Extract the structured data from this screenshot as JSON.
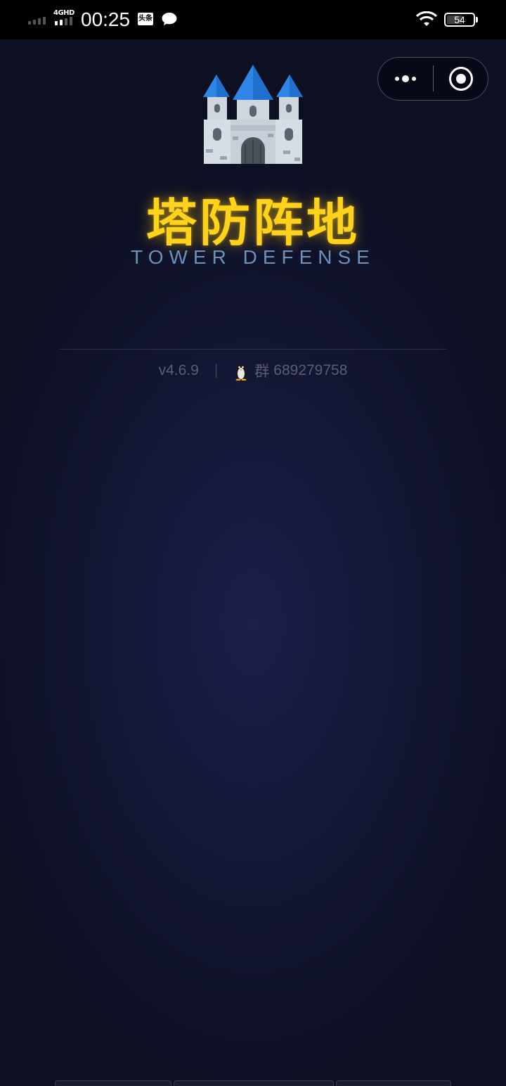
{
  "status_bar": {
    "network": "4GHD",
    "time": "00:25",
    "toutiao_badge": "头条",
    "battery": "54"
  },
  "capsule": {
    "more_icon": "more-dots-icon",
    "close_icon": "close-circle-icon"
  },
  "hero": {
    "icon": "castle-icon",
    "title": "塔防阵地",
    "subtitle": "TOWER DEFENSE"
  },
  "footer": {
    "version": "v4.6.9",
    "separator": "|",
    "qq_icon": "penguin-icon",
    "group_label": "群",
    "group_number": "689279758"
  },
  "colors": {
    "title": "#ffd21c",
    "subtitle": "#6d8fb8",
    "background": "#0e1026"
  }
}
